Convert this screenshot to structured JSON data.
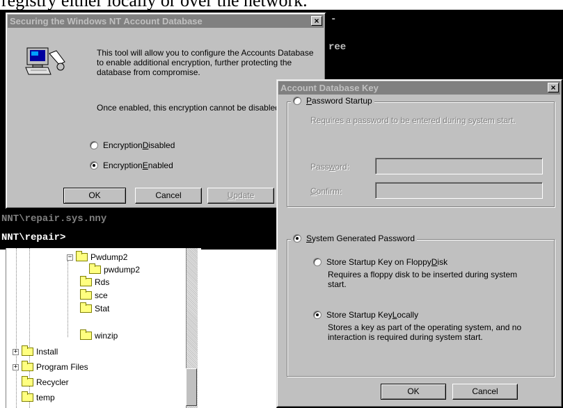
{
  "document": {
    "text": "registry either locally or over the network."
  },
  "console": {
    "line1": "-",
    "line2": "ree",
    "line3": "NNT\\repair.sys.nny",
    "prompt": "NNT\\repair>"
  },
  "explorer": {
    "items": [
      {
        "label": "Pwdump2"
      },
      {
        "label": "pwdump2"
      },
      {
        "label": "Rds"
      },
      {
        "label": "sce"
      },
      {
        "label": "Stat"
      },
      {
        "label": "winzip"
      },
      {
        "label": "Install"
      },
      {
        "label": "Program Files"
      },
      {
        "label": "Recycler"
      },
      {
        "label": "temp"
      }
    ]
  },
  "dialog1": {
    "title": "Securing the Windows NT Account Database",
    "close": "×",
    "description": "This tool will allow you to configure the Accounts Database to enable additional encryption, further protecting the database from compromise.",
    "warning": "Once enabled, this encryption cannot be disabled.",
    "radio_disabled": {
      "pre": "Encryption ",
      "key": "D",
      "post": "isabled",
      "checked": false
    },
    "radio_enabled": {
      "pre": "Encryption ",
      "key": "E",
      "post": "nabled",
      "checked": true
    },
    "ok": "OK",
    "cancel": "Cancel",
    "update": {
      "key": "U",
      "post": "pdate"
    }
  },
  "dialog2": {
    "title": "Account Database Key",
    "close": "×",
    "password_startup": {
      "key": "P",
      "post": "assword Startup",
      "checked": false
    },
    "password_startup_desc": "Requires a password to be entered during system start.",
    "password_label": {
      "pre": "Pass",
      "key": "w",
      "post": "ord:"
    },
    "confirm_label": {
      "key": "C",
      "post": "onfirm:"
    },
    "password_value": "",
    "confirm_value": "",
    "system_generated": {
      "key": "S",
      "post": "ystem Generated Password",
      "checked": true
    },
    "floppy": {
      "pre": "Store Startup Key on Floppy ",
      "key": "D",
      "post": "isk",
      "checked": false
    },
    "floppy_desc": "Requires a floppy disk to be inserted during system start.",
    "locally": {
      "pre": "Store Startup Key ",
      "key": "L",
      "post": "ocally",
      "checked": true
    },
    "locally_desc": "Stores a key as part of the operating system, and no interaction is required during system start.",
    "ok": "OK",
    "cancel": "Cancel"
  }
}
